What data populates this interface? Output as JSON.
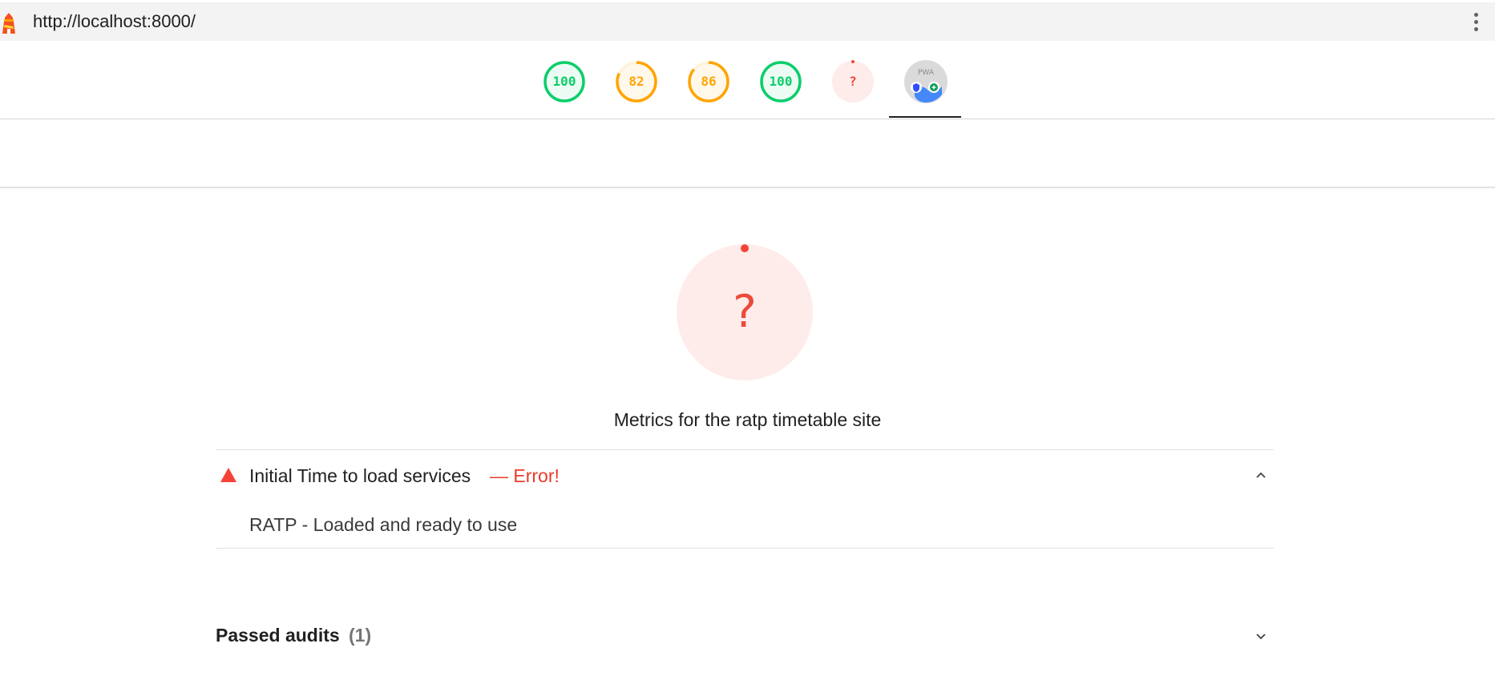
{
  "browser": {
    "url": "http://localhost:8000/",
    "logo_icon": "lighthouse-icon",
    "menu_icon": "vertical-dots-icon"
  },
  "gauges": [
    {
      "label": "100",
      "score": 1.0,
      "color": "#0cce6b",
      "bg": "#ffffff"
    },
    {
      "label": "82",
      "score": 0.82,
      "color": "#ffa400",
      "bg": "#ffffff"
    },
    {
      "label": "86",
      "score": 0.86,
      "color": "#ffa400",
      "bg": "#ffffff"
    },
    {
      "label": "100",
      "score": 1.0,
      "color": "#0cce6b",
      "bg": "#ffffff"
    },
    {
      "label": "?",
      "score": 0,
      "color": "#eb4b3a",
      "bg": "#feecea"
    }
  ],
  "pwa_badge": {
    "label": "PWA",
    "icon": "pwa-badge-icon",
    "selected": true
  },
  "category": {
    "score_label": "?",
    "status_color": "#eb4b3a",
    "title": "Metrics for the ratp timetable site"
  },
  "audit": {
    "icon": "fail-triangle-icon",
    "title": "Initial Time to load services",
    "error": "— Error!",
    "description": "RATP - Loaded and ready to use",
    "expanded": true
  },
  "passed_audits": {
    "label": "Passed audits",
    "count": "(1)",
    "expanded": false
  }
}
